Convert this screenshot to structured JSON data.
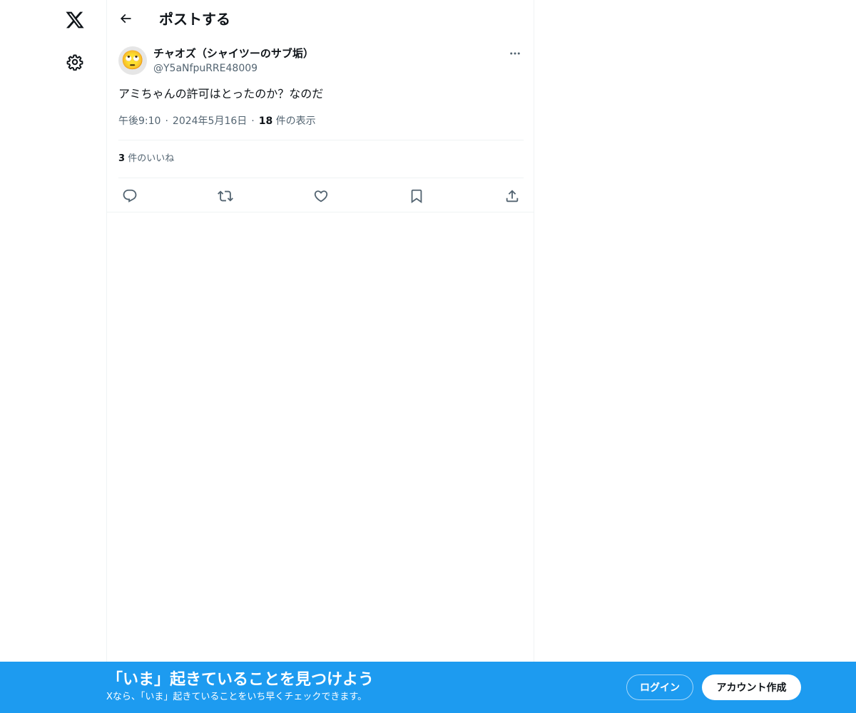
{
  "header": {
    "title": "ポストする"
  },
  "post": {
    "avatar_emoji": "🙄",
    "display_name": "チャオズ（シャイツーのサブ垢）",
    "handle": "@Y5aNfpuRRE48009",
    "text": "アミちゃんの許可はとったのか？なのだ",
    "time": "午後9:10",
    "date": "2024年5月16日",
    "view_count": "18",
    "view_label": "件の表示",
    "like_count": "3",
    "like_label": "件のいいね",
    "separator": "·"
  },
  "banner": {
    "title": "「いま」起きていることを見つけよう",
    "subtitle": "Xなら、「いま」起きていることをいち早くチェックできます。",
    "login_label": "ログイン",
    "signup_label": "アカウント作成"
  },
  "icons": {
    "logo": "x-logo-icon",
    "settings": "gear-icon",
    "back": "arrow-left-icon",
    "more": "more-horizontal-icon",
    "reply": "reply-icon",
    "repost": "repost-icon",
    "like": "heart-icon",
    "bookmark": "bookmark-icon",
    "share": "share-icon"
  },
  "colors": {
    "accent": "#1d9bf0",
    "text_primary": "#0f1419",
    "text_secondary": "#536471",
    "border": "#eff3f4",
    "background": "#ffffff"
  }
}
